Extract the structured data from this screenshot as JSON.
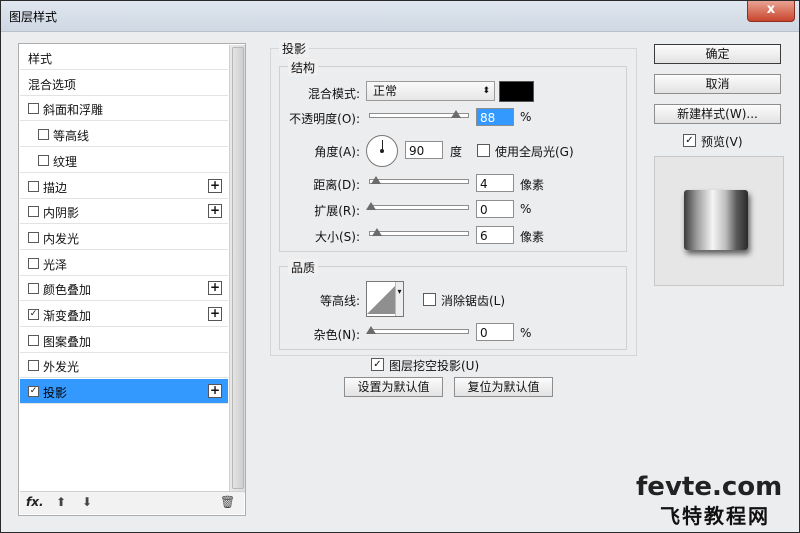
{
  "window": {
    "title": "图层样式",
    "close": "x"
  },
  "style_list": {
    "items": [
      {
        "label": "样式",
        "checkbox": false,
        "checked": false,
        "plus": false,
        "indent": 0,
        "selected": false
      },
      {
        "label": "混合选项",
        "checkbox": false,
        "checked": false,
        "plus": false,
        "indent": 0,
        "selected": false
      },
      {
        "label": "斜面和浮雕",
        "checkbox": true,
        "checked": false,
        "plus": false,
        "indent": 0,
        "selected": false
      },
      {
        "label": "等高线",
        "checkbox": true,
        "checked": false,
        "plus": false,
        "indent": 1,
        "selected": false
      },
      {
        "label": "纹理",
        "checkbox": true,
        "checked": false,
        "plus": false,
        "indent": 1,
        "selected": false
      },
      {
        "label": "描边",
        "checkbox": true,
        "checked": false,
        "plus": true,
        "indent": 0,
        "selected": false
      },
      {
        "label": "内阴影",
        "checkbox": true,
        "checked": false,
        "plus": true,
        "indent": 0,
        "selected": false
      },
      {
        "label": "内发光",
        "checkbox": true,
        "checked": false,
        "plus": false,
        "indent": 0,
        "selected": false
      },
      {
        "label": "光泽",
        "checkbox": true,
        "checked": false,
        "plus": false,
        "indent": 0,
        "selected": false
      },
      {
        "label": "颜色叠加",
        "checkbox": true,
        "checked": false,
        "plus": true,
        "indent": 0,
        "selected": false
      },
      {
        "label": "渐变叠加",
        "checkbox": true,
        "checked": true,
        "plus": true,
        "indent": 0,
        "selected": false
      },
      {
        "label": "图案叠加",
        "checkbox": true,
        "checked": false,
        "plus": false,
        "indent": 0,
        "selected": false
      },
      {
        "label": "外发光",
        "checkbox": true,
        "checked": false,
        "plus": false,
        "indent": 0,
        "selected": false
      },
      {
        "label": "投影",
        "checkbox": true,
        "checked": true,
        "plus": true,
        "indent": 0,
        "selected": true
      }
    ],
    "footer": {
      "fx": "fx.",
      "up": "⬆",
      "down": "⬇",
      "trash": "🗑"
    }
  },
  "drop_shadow": {
    "section_title": "投影",
    "structure": {
      "title": "结构",
      "blend_mode_label": "混合模式:",
      "blend_mode_value": "正常",
      "shadow_color": "#000000",
      "opacity_label": "不透明度(O):",
      "opacity_value": "88",
      "opacity_unit": "%",
      "opacity_fraction": 0.88,
      "angle_label": "角度(A):",
      "angle_value": "90",
      "angle_unit": "度",
      "global_light_label": "使用全局光(G)",
      "global_light_checked": false,
      "distance_label": "距离(D):",
      "distance_value": "4",
      "distance_unit": "像素",
      "spread_label": "扩展(R):",
      "spread_value": "0",
      "spread_unit": "%",
      "size_label": "大小(S):",
      "size_value": "6",
      "size_unit": "像素"
    },
    "quality": {
      "title": "品质",
      "contour_label": "等高线:",
      "anti_alias_label": "消除锯齿(L)",
      "anti_alias_checked": false,
      "noise_label": "杂色(N):",
      "noise_value": "0",
      "noise_unit": "%"
    },
    "knockout_label": "图层挖空投影(U)",
    "knockout_checked": true,
    "make_default": "设置为默认值",
    "reset_default": "复位为默认值"
  },
  "buttons": {
    "ok": "确定",
    "cancel": "取消",
    "new_style": "新建样式(W)...",
    "preview_label": "预览(V)",
    "preview_checked": true
  },
  "watermark": {
    "line1": "fevte.com",
    "line2": "飞特教程网"
  }
}
